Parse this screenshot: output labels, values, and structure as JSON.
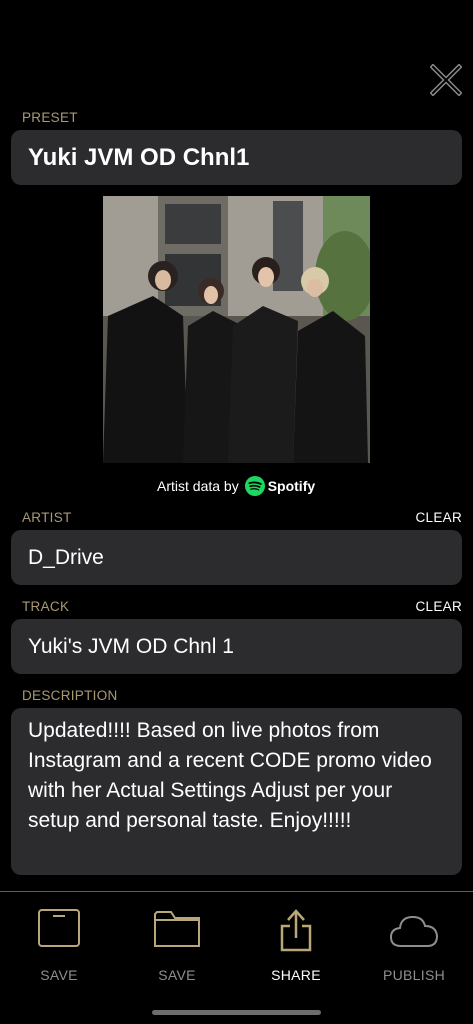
{
  "preset": {
    "label": "PRESET",
    "value": "Yuki JVM OD Chnl1"
  },
  "attribution": {
    "prefix": "Artist data by",
    "brand": "Spotify"
  },
  "artist": {
    "label": "ARTIST",
    "clear": "CLEAR",
    "value": "D_Drive"
  },
  "track": {
    "label": "TRACK",
    "clear": "CLEAR",
    "value": "Yuki's JVM OD Chnl 1"
  },
  "description": {
    "label": "DESCRIPTION",
    "value": "Updated!!!! Based on live photos from Instagram and a recent CODE promo video with her Actual Settings Adjust per your setup and personal taste.  Enjoy!!!!!"
  },
  "toolbar": {
    "items": [
      {
        "label": "SAVE",
        "icon": "save-icon"
      },
      {
        "label": "SAVE",
        "icon": "folder-icon"
      },
      {
        "label": "SHARE",
        "icon": "share-icon"
      },
      {
        "label": "PUBLISH",
        "icon": "cloud-icon"
      }
    ]
  },
  "colors": {
    "background": "#000000",
    "field": "#2c2c2e",
    "label_gold": "#a89a74",
    "spotify_green": "#1ed760",
    "icon_gold": "#b9a77c"
  }
}
